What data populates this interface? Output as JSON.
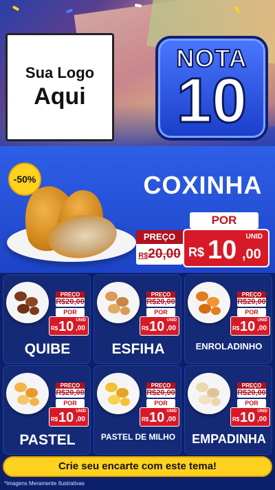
{
  "brand": {
    "logo_line1": "Sua Logo",
    "logo_line2": "Aqui",
    "badge_word": "NOTA",
    "badge_number": "10"
  },
  "main_offer": {
    "discount_badge": "-50%",
    "product": "COXINHA",
    "por_label": "POR",
    "preco_label": "PREÇO",
    "old_price_prefix": "R$",
    "old_price": "20,00",
    "unid_label": "UNID",
    "currency": "R$",
    "price_int": "10",
    "price_dec": ",00"
  },
  "products": [
    {
      "name": "QUIBE",
      "preco_label": "PREÇO",
      "old_price": "R$20,00",
      "por_label": "POR",
      "unid_label": "UNID",
      "currency": "R$",
      "price_int": "10",
      "price_dec": ",00",
      "icon": "quibe-icon"
    },
    {
      "name": "ESFIHA",
      "preco_label": "PREÇO",
      "old_price": "R$20,00",
      "por_label": "POR",
      "unid_label": "UNID",
      "currency": "R$",
      "price_int": "10",
      "price_dec": ",00",
      "icon": "esfiha-icon"
    },
    {
      "name": "ENROLADINHO",
      "preco_label": "PREÇO",
      "old_price": "R$20,00",
      "por_label": "POR",
      "unid_label": "UNID",
      "currency": "R$",
      "price_int": "10",
      "price_dec": ",00",
      "icon": "enroladinho-icon"
    },
    {
      "name": "PASTEL",
      "preco_label": "PREÇO",
      "old_price": "R$20,00",
      "por_label": "POR",
      "unid_label": "UNID",
      "currency": "R$",
      "price_int": "10",
      "price_dec": ",00",
      "icon": "pastel-icon"
    },
    {
      "name": "PASTEL DE MILHO",
      "preco_label": "PREÇO",
      "old_price": "R$20,00",
      "por_label": "POR",
      "unid_label": "UNID",
      "currency": "R$",
      "price_int": "10",
      "price_dec": ",00",
      "icon": "pastel-de-milho-icon"
    },
    {
      "name": "EMPADINHA",
      "preco_label": "PREÇO",
      "old_price": "R$20,00",
      "por_label": "POR",
      "unid_label": "UNID",
      "currency": "R$",
      "price_int": "10",
      "price_dec": ",00",
      "icon": "empadinha-icon"
    }
  ],
  "cta": "Crie seu encarte com este tema!",
  "disclaimer": "*Imagens Meramente Ilustrativas",
  "colors": {
    "background": "#0b1f6b",
    "accent_yellow": "#ffd21f",
    "price_red": "#d71a28",
    "panel_blue": "#2e5fe6"
  }
}
